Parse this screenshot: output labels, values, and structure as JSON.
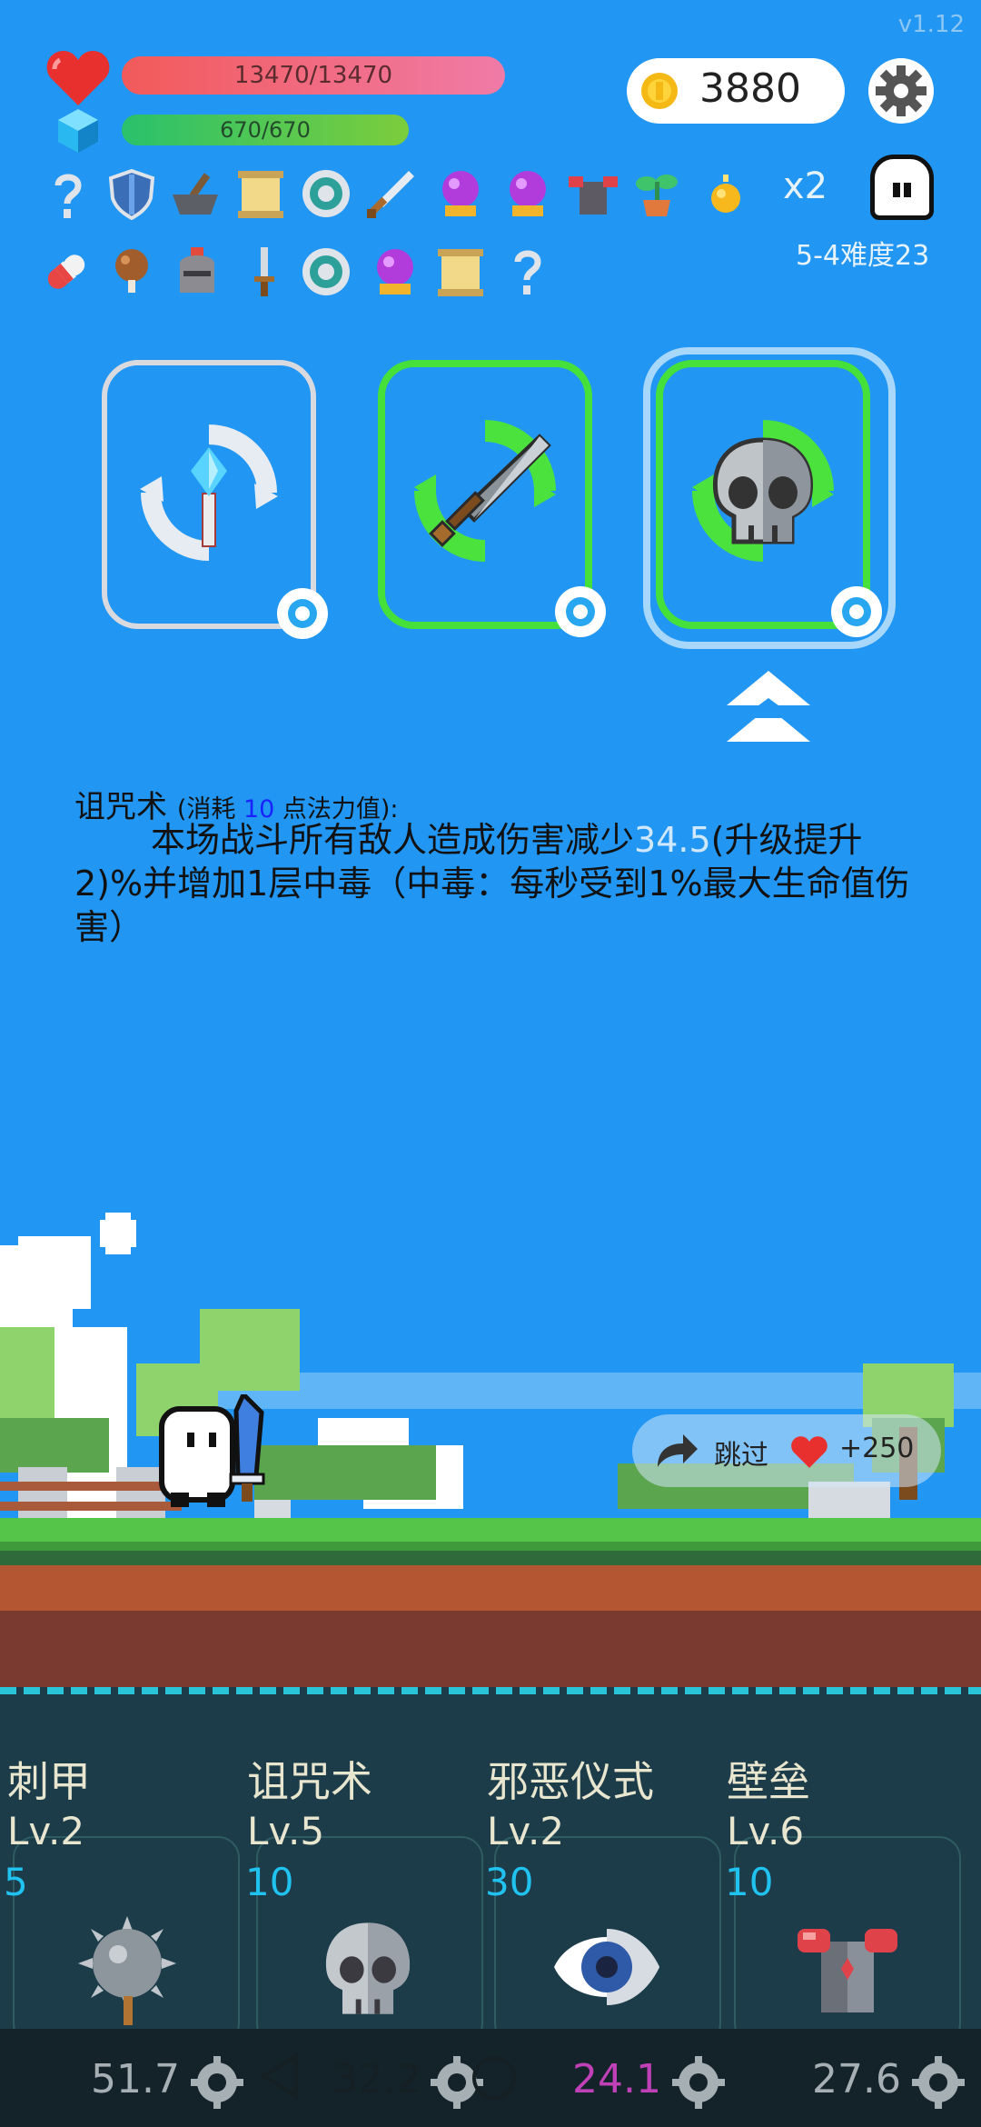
{
  "version": "v1.12",
  "hp": {
    "text": "13470/13470",
    "fraction": 1.0
  },
  "mp": {
    "text": "670/670",
    "fraction": 1.0
  },
  "coins": "3880",
  "speed": "x2",
  "stage": "5-4难度23",
  "inventory_row1": [
    "question-hook-icon",
    "shield-icon",
    "mortar-pestle-icon",
    "scroll-icon",
    "ring-target-icon",
    "sword-icon",
    "crystal-ball-icon",
    "crystal-ball-icon",
    "chest-armor-icon",
    "potted-plant-icon",
    "spark-orb-icon"
  ],
  "inventory_row2": [
    "pill-capsule-icon",
    "meat-drumstick-icon",
    "helmet-icon",
    "dagger-icon",
    "ring-target-icon",
    "crystal-ball-icon",
    "scroll-icon",
    "question-hook-icon"
  ],
  "cards": [
    {
      "icon": "magic-wand-icon",
      "border": "#d9d9e0"
    },
    {
      "icon": "steel-sword-icon",
      "border": "#46e03a"
    },
    {
      "icon": "skull-icon",
      "border": "#46e03a",
      "selected": true
    }
  ],
  "description": {
    "name": "诅咒术",
    "cost_prefix": "(消耗 ",
    "cost_value": "10",
    "cost_suffix": " 点法力值):",
    "line_a": "本场战斗所有敌人造成伤害减少",
    "highlight": "34.5",
    "line_b": "(升级提升2)%并增加1层中毒（中毒：每秒受到1%最大生命值伤害）"
  },
  "skip": {
    "label": "跳过",
    "bonus": "+250"
  },
  "skills": [
    {
      "name": "刺甲",
      "level": "Lv.2",
      "cost": "5",
      "icon": "spiked-mace-icon",
      "cooldown": "51.7"
    },
    {
      "name": "诅咒术",
      "level": "Lv.5",
      "cost": "10",
      "icon": "skull-icon",
      "cooldown": "32.2"
    },
    {
      "name": "邪恶仪式",
      "level": "Lv.2",
      "cost": "30",
      "icon": "eye-icon",
      "cooldown": "24.1"
    },
    {
      "name": "壁垒",
      "level": "Lv.6",
      "cost": "10",
      "icon": "armor-icon",
      "cooldown": "27.6"
    }
  ],
  "colors": {
    "background": "#2196f3",
    "hp": "#f25a5a",
    "mp": "#29c16c",
    "cost_blue": "#20c3f0",
    "highlight_purple": "#c040b8"
  }
}
